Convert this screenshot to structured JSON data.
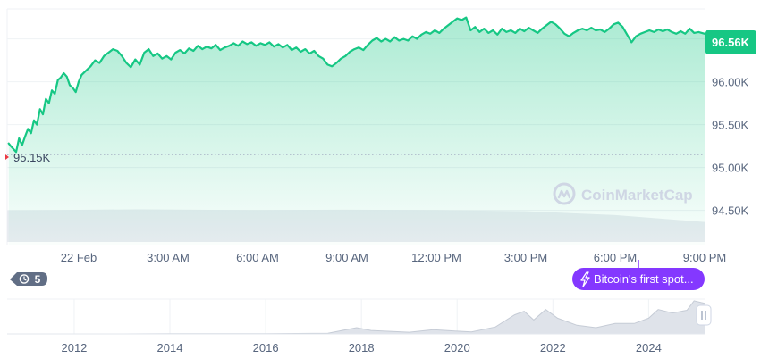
{
  "chart_data": {
    "type": "area",
    "title": "",
    "xlabel": "",
    "ylabel": "",
    "ylim": [
      94.1,
      96.85
    ],
    "y_ticks": [
      94.5,
      95.0,
      95.5,
      96.0
    ],
    "y_tick_labels": [
      "94.50K",
      "95.00K",
      "95.50K",
      "96.00K"
    ],
    "x_ticks": [
      {
        "label": "22 Feb",
        "hour": 0
      },
      {
        "label": "3:00 AM",
        "hour": 3
      },
      {
        "label": "6:00 AM",
        "hour": 6
      },
      {
        "label": "9:00 AM",
        "hour": 9
      },
      {
        "label": "12:00 PM",
        "hour": 12
      },
      {
        "label": "3:00 PM",
        "hour": 15
      },
      {
        "label": "6:00 PM",
        "hour": 18
      },
      {
        "label": "9:00 PM",
        "hour": 21
      }
    ],
    "x_range_hours": [
      -2.4,
      21.0
    ],
    "grid": true,
    "current_price_label": "96.56K",
    "start_price_label": "95.15K",
    "start_price": 95.15,
    "series": [
      {
        "points": [
          [
            -2.35,
            95.28
          ],
          [
            -2.28,
            95.25
          ],
          [
            -2.2,
            95.22
          ],
          [
            -2.1,
            95.18
          ],
          [
            -2.0,
            95.34
          ],
          [
            -1.9,
            95.26
          ],
          [
            -1.8,
            95.36
          ],
          [
            -1.7,
            95.45
          ],
          [
            -1.6,
            95.4
          ],
          [
            -1.5,
            95.55
          ],
          [
            -1.4,
            95.5
          ],
          [
            -1.3,
            95.68
          ],
          [
            -1.2,
            95.62
          ],
          [
            -1.1,
            95.8
          ],
          [
            -1.0,
            95.75
          ],
          [
            -0.9,
            95.9
          ],
          [
            -0.8,
            95.86
          ],
          [
            -0.7,
            96.02
          ],
          [
            -0.6,
            96.05
          ],
          [
            -0.5,
            96.1
          ],
          [
            -0.4,
            96.06
          ],
          [
            -0.3,
            95.96
          ],
          [
            -0.2,
            95.93
          ],
          [
            -0.1,
            95.88
          ],
          [
            0.0,
            96.0
          ],
          [
            0.1,
            96.08
          ],
          [
            0.25,
            96.13
          ],
          [
            0.4,
            96.18
          ],
          [
            0.55,
            96.25
          ],
          [
            0.7,
            96.22
          ],
          [
            0.85,
            96.3
          ],
          [
            1.0,
            96.34
          ],
          [
            1.15,
            96.38
          ],
          [
            1.3,
            96.36
          ],
          [
            1.45,
            96.3
          ],
          [
            1.6,
            96.22
          ],
          [
            1.75,
            96.17
          ],
          [
            1.9,
            96.26
          ],
          [
            2.05,
            96.2
          ],
          [
            2.2,
            96.34
          ],
          [
            2.35,
            96.38
          ],
          [
            2.5,
            96.3
          ],
          [
            2.65,
            96.33
          ],
          [
            2.8,
            96.27
          ],
          [
            2.95,
            96.3
          ],
          [
            3.1,
            96.26
          ],
          [
            3.25,
            96.34
          ],
          [
            3.4,
            96.37
          ],
          [
            3.55,
            96.33
          ],
          [
            3.7,
            96.39
          ],
          [
            3.85,
            96.36
          ],
          [
            4.0,
            96.42
          ],
          [
            4.15,
            96.38
          ],
          [
            4.3,
            96.41
          ],
          [
            4.45,
            96.39
          ],
          [
            4.6,
            96.43
          ],
          [
            4.75,
            96.37
          ],
          [
            4.9,
            96.4
          ],
          [
            5.05,
            96.42
          ],
          [
            5.2,
            96.45
          ],
          [
            5.35,
            96.42
          ],
          [
            5.5,
            96.47
          ],
          [
            5.65,
            96.44
          ],
          [
            5.8,
            96.46
          ],
          [
            5.95,
            96.42
          ],
          [
            6.1,
            96.45
          ],
          [
            6.25,
            96.43
          ],
          [
            6.4,
            96.46
          ],
          [
            6.55,
            96.41
          ],
          [
            6.7,
            96.44
          ],
          [
            6.85,
            96.4
          ],
          [
            7.0,
            96.43
          ],
          [
            7.15,
            96.37
          ],
          [
            7.3,
            96.4
          ],
          [
            7.45,
            96.35
          ],
          [
            7.6,
            96.38
          ],
          [
            7.75,
            96.33
          ],
          [
            7.9,
            96.36
          ],
          [
            8.05,
            96.3
          ],
          [
            8.2,
            96.27
          ],
          [
            8.35,
            96.2
          ],
          [
            8.5,
            96.18
          ],
          [
            8.65,
            96.22
          ],
          [
            8.8,
            96.27
          ],
          [
            8.95,
            96.3
          ],
          [
            9.1,
            96.35
          ],
          [
            9.25,
            96.38
          ],
          [
            9.4,
            96.4
          ],
          [
            9.55,
            96.37
          ],
          [
            9.7,
            96.43
          ],
          [
            9.85,
            96.48
          ],
          [
            10.0,
            96.51
          ],
          [
            10.15,
            96.47
          ],
          [
            10.3,
            96.5
          ],
          [
            10.45,
            96.47
          ],
          [
            10.6,
            96.52
          ],
          [
            10.75,
            96.48
          ],
          [
            10.9,
            96.5
          ],
          [
            11.05,
            96.48
          ],
          [
            11.2,
            96.53
          ],
          [
            11.35,
            96.5
          ],
          [
            11.5,
            96.55
          ],
          [
            11.65,
            96.58
          ],
          [
            11.8,
            96.56
          ],
          [
            11.95,
            96.6
          ],
          [
            12.1,
            96.57
          ],
          [
            12.25,
            96.62
          ],
          [
            12.4,
            96.66
          ],
          [
            12.55,
            96.7
          ],
          [
            12.7,
            96.74
          ],
          [
            12.85,
            96.72
          ],
          [
            13.0,
            96.75
          ],
          [
            13.15,
            96.6
          ],
          [
            13.3,
            96.64
          ],
          [
            13.45,
            96.58
          ],
          [
            13.6,
            96.62
          ],
          [
            13.75,
            96.57
          ],
          [
            13.9,
            96.6
          ],
          [
            14.05,
            96.55
          ],
          [
            14.2,
            96.62
          ],
          [
            14.35,
            96.58
          ],
          [
            14.5,
            96.6
          ],
          [
            14.65,
            96.57
          ],
          [
            14.8,
            96.62
          ],
          [
            14.95,
            96.59
          ],
          [
            15.1,
            96.63
          ],
          [
            15.25,
            96.6
          ],
          [
            15.4,
            96.57
          ],
          [
            15.55,
            96.62
          ],
          [
            15.7,
            96.66
          ],
          [
            15.85,
            96.7
          ],
          [
            16.0,
            96.67
          ],
          [
            16.15,
            96.62
          ],
          [
            16.3,
            96.56
          ],
          [
            16.45,
            96.53
          ],
          [
            16.6,
            96.57
          ],
          [
            16.75,
            96.6
          ],
          [
            16.9,
            96.62
          ],
          [
            17.05,
            96.6
          ],
          [
            17.2,
            96.63
          ],
          [
            17.35,
            96.6
          ],
          [
            17.5,
            96.61
          ],
          [
            17.65,
            96.58
          ],
          [
            17.8,
            96.62
          ],
          [
            17.95,
            96.67
          ],
          [
            18.1,
            96.69
          ],
          [
            18.25,
            96.64
          ],
          [
            18.4,
            96.55
          ],
          [
            18.55,
            96.46
          ],
          [
            18.7,
            96.53
          ],
          [
            18.85,
            96.56
          ],
          [
            19.0,
            96.58
          ],
          [
            19.15,
            96.6
          ],
          [
            19.3,
            96.58
          ],
          [
            19.45,
            96.61
          ],
          [
            19.6,
            96.59
          ],
          [
            19.75,
            96.61
          ],
          [
            19.9,
            96.58
          ],
          [
            20.05,
            96.56
          ],
          [
            20.2,
            96.59
          ],
          [
            20.35,
            96.56
          ],
          [
            20.5,
            96.62
          ],
          [
            20.65,
            96.57
          ],
          [
            20.8,
            96.58
          ],
          [
            21.0,
            96.56
          ]
        ]
      }
    ],
    "volume": {
      "x_range": [
        -2.4,
        21.0
      ],
      "points": [
        [
          -2.4,
          0.82
        ],
        [
          2.0,
          0.85
        ],
        [
          6.0,
          0.83
        ],
        [
          9.0,
          0.84
        ],
        [
          12.0,
          0.83
        ],
        [
          15.0,
          0.8
        ],
        [
          18.0,
          0.7
        ],
        [
          21.0,
          0.52
        ]
      ]
    },
    "history": {
      "type": "area",
      "x_ticks": [
        2012,
        2014,
        2016,
        2018,
        2020,
        2022,
        2024
      ],
      "x_range": [
        2010.6,
        2025.17
      ],
      "points": [
        [
          2010.6,
          0.0
        ],
        [
          2013.0,
          0.0
        ],
        [
          2014.0,
          0.005
        ],
        [
          2016.0,
          0.005
        ],
        [
          2017.3,
          0.02
        ],
        [
          2017.9,
          0.18
        ],
        [
          2018.2,
          0.1
        ],
        [
          2019.0,
          0.05
        ],
        [
          2019.5,
          0.12
        ],
        [
          2020.0,
          0.08
        ],
        [
          2020.3,
          0.06
        ],
        [
          2020.8,
          0.2
        ],
        [
          2021.2,
          0.55
        ],
        [
          2021.4,
          0.65
        ],
        [
          2021.6,
          0.4
        ],
        [
          2021.85,
          0.7
        ],
        [
          2022.1,
          0.45
        ],
        [
          2022.5,
          0.25
        ],
        [
          2022.9,
          0.18
        ],
        [
          2023.3,
          0.3
        ],
        [
          2023.7,
          0.3
        ],
        [
          2024.0,
          0.45
        ],
        [
          2024.2,
          0.7
        ],
        [
          2024.5,
          0.6
        ],
        [
          2024.8,
          0.68
        ],
        [
          2024.95,
          0.95
        ],
        [
          2025.1,
          0.9
        ],
        [
          2025.17,
          0.88
        ]
      ]
    }
  },
  "watermark": {
    "text": "CoinMarketCap",
    "icon": "coinmarketcap-logo-icon"
  },
  "event": {
    "label": "Bitcoin's first spot...",
    "icon": "lightning-bolt-icon"
  },
  "history_button": {
    "count": "5",
    "icon": "history-clock-icon"
  },
  "scroll_handle": {
    "icon": "pause-handle-icon"
  },
  "colors": {
    "line": "#16c784",
    "price_tag": "#16c784",
    "event": "#8438ff",
    "pill": "#616e85",
    "grid": "#eff2f5",
    "volume": "#e9ecf1",
    "history_fill": "#dfe3ea",
    "history_line": "#c6ccd6"
  }
}
